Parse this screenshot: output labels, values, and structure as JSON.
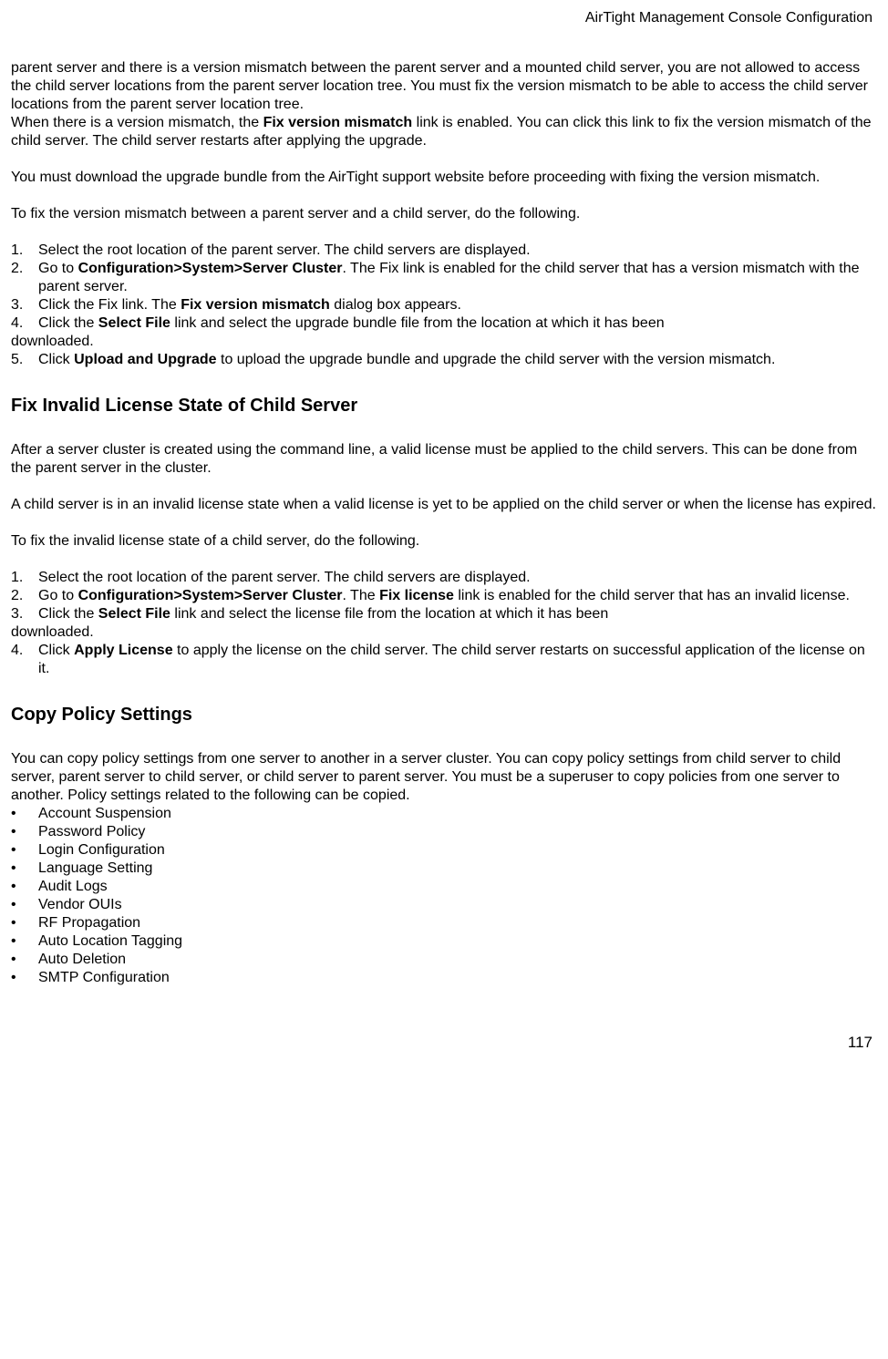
{
  "header": {
    "right": "AirTight Management Console Configuration"
  },
  "intro": {
    "p1_a": "parent server and there is a version mismatch between the parent server and a mounted child server,  you are not allowed to access the child server locations from the parent server location tree. You must fix the version mismatch to be able to access the child server locations from the parent server location tree.",
    "p1_b_pre": "When there is a version mismatch, the ",
    "p1_b_bold": "Fix version mismatch",
    "p1_b_post": " link is enabled. You can click this link to fix the version mismatch of the child server. The child server restarts after applying the upgrade.",
    "p2": "You must download the upgrade bundle from the AirTight support website before proceeding with fixing the version mismatch.",
    "p3": "To fix the version mismatch between a parent server and a child server, do the following."
  },
  "list1": {
    "i1": {
      "num": "1.",
      "text": "Select the root location of the parent server. The child servers are displayed."
    },
    "i2": {
      "num": "2.",
      "pre": "Go to ",
      "b": "Configuration>System>Server Cluster",
      "post": ". The Fix link is enabled for the child server that has a version mismatch with the parent server."
    },
    "i3": {
      "num": "3.",
      "pre": "Click the Fix link. The ",
      "b": "Fix version mismatch",
      "post": " dialog box appears."
    },
    "i4": {
      "num": "4.",
      "pre": "Click the ",
      "b": "Select File",
      "post": " link and select the upgrade bundle file from the location at which it has been",
      "cont": "downloaded."
    },
    "i5": {
      "num": "5.",
      "pre": "Click ",
      "b": "Upload and Upgrade",
      "post": " to upload the upgrade bundle and upgrade the child server with the version mismatch."
    }
  },
  "section2": {
    "heading": "Fix Invalid License State of Child Server",
    "p1": "After a server cluster is created using the command line, a valid license must be applied to the child servers. This can be done from the parent server in the cluster.",
    "p2": "A child server is in an invalid license state when a valid license is yet to be applied on the child server or when the license has expired.",
    "p3": "To fix the invalid license state of a child server, do the following."
  },
  "list2": {
    "i1": {
      "num": "1.",
      "text": "Select the root location of the parent server. The child servers are displayed."
    },
    "i2": {
      "num": "2.",
      "pre": "Go to ",
      "b": "Configuration>System>Server Cluster",
      "mid": ". The ",
      "b2": "Fix license",
      "post": " link is enabled for the child server that has an invalid license."
    },
    "i3": {
      "num": "3.",
      "pre": "Click the ",
      "b": "Select File",
      "post": " link and select the license file from the location at which it has been",
      "cont": "downloaded."
    },
    "i4": {
      "num": "4.",
      "pre": "Click ",
      "b": "Apply License",
      "post": " to apply the license on the child server. The child server restarts on successful application of the license on it."
    }
  },
  "section3": {
    "heading": "Copy Policy Settings",
    "p1": "You can copy policy settings from one server to another in a server cluster. You can copy policy settings from child server to child server, parent server to child server, or child server to parent server. You must be a superuser to copy policies from one server to another. Policy settings related to the following can be copied."
  },
  "bullets": {
    "b1": "Account Suspension",
    "b2": "Password Policy",
    "b3": "Login Configuration",
    "b4": "Language Setting",
    "b5": "Audit Logs",
    "b6": "Vendor OUIs",
    "b7": "RF Propagation",
    "b8": "Auto Location Tagging",
    "b9": "Auto Deletion",
    "b10": "SMTP Configuration"
  },
  "footer": {
    "page_number": "117"
  }
}
